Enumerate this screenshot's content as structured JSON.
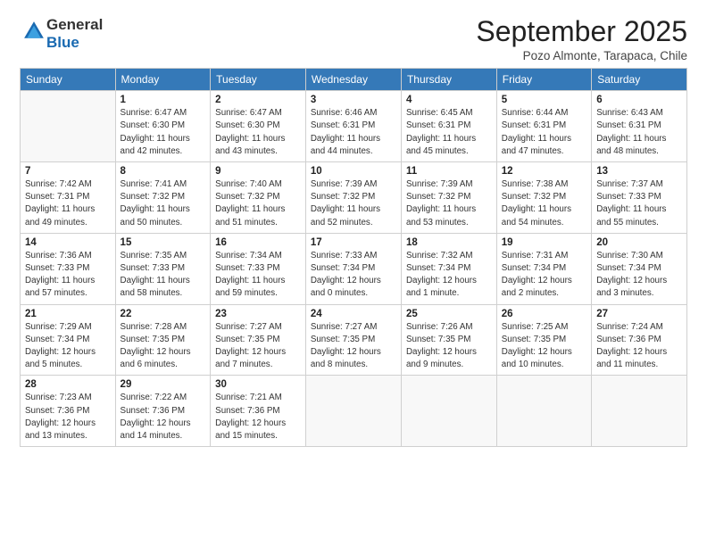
{
  "logo": {
    "general": "General",
    "blue": "Blue"
  },
  "header": {
    "month": "September 2025",
    "location": "Pozo Almonte, Tarapaca, Chile"
  },
  "weekdays": [
    "Sunday",
    "Monday",
    "Tuesday",
    "Wednesday",
    "Thursday",
    "Friday",
    "Saturday"
  ],
  "weeks": [
    [
      {
        "day": null,
        "info": null
      },
      {
        "day": "1",
        "info": "Sunrise: 6:47 AM\nSunset: 6:30 PM\nDaylight: 11 hours\nand 42 minutes."
      },
      {
        "day": "2",
        "info": "Sunrise: 6:47 AM\nSunset: 6:30 PM\nDaylight: 11 hours\nand 43 minutes."
      },
      {
        "day": "3",
        "info": "Sunrise: 6:46 AM\nSunset: 6:31 PM\nDaylight: 11 hours\nand 44 minutes."
      },
      {
        "day": "4",
        "info": "Sunrise: 6:45 AM\nSunset: 6:31 PM\nDaylight: 11 hours\nand 45 minutes."
      },
      {
        "day": "5",
        "info": "Sunrise: 6:44 AM\nSunset: 6:31 PM\nDaylight: 11 hours\nand 47 minutes."
      },
      {
        "day": "6",
        "info": "Sunrise: 6:43 AM\nSunset: 6:31 PM\nDaylight: 11 hours\nand 48 minutes."
      }
    ],
    [
      {
        "day": "7",
        "info": "Sunrise: 7:42 AM\nSunset: 7:31 PM\nDaylight: 11 hours\nand 49 minutes."
      },
      {
        "day": "8",
        "info": "Sunrise: 7:41 AM\nSunset: 7:32 PM\nDaylight: 11 hours\nand 50 minutes."
      },
      {
        "day": "9",
        "info": "Sunrise: 7:40 AM\nSunset: 7:32 PM\nDaylight: 11 hours\nand 51 minutes."
      },
      {
        "day": "10",
        "info": "Sunrise: 7:39 AM\nSunset: 7:32 PM\nDaylight: 11 hours\nand 52 minutes."
      },
      {
        "day": "11",
        "info": "Sunrise: 7:39 AM\nSunset: 7:32 PM\nDaylight: 11 hours\nand 53 minutes."
      },
      {
        "day": "12",
        "info": "Sunrise: 7:38 AM\nSunset: 7:32 PM\nDaylight: 11 hours\nand 54 minutes."
      },
      {
        "day": "13",
        "info": "Sunrise: 7:37 AM\nSunset: 7:33 PM\nDaylight: 11 hours\nand 55 minutes."
      }
    ],
    [
      {
        "day": "14",
        "info": "Sunrise: 7:36 AM\nSunset: 7:33 PM\nDaylight: 11 hours\nand 57 minutes."
      },
      {
        "day": "15",
        "info": "Sunrise: 7:35 AM\nSunset: 7:33 PM\nDaylight: 11 hours\nand 58 minutes."
      },
      {
        "day": "16",
        "info": "Sunrise: 7:34 AM\nSunset: 7:33 PM\nDaylight: 11 hours\nand 59 minutes."
      },
      {
        "day": "17",
        "info": "Sunrise: 7:33 AM\nSunset: 7:34 PM\nDaylight: 12 hours\nand 0 minutes."
      },
      {
        "day": "18",
        "info": "Sunrise: 7:32 AM\nSunset: 7:34 PM\nDaylight: 12 hours\nand 1 minute."
      },
      {
        "day": "19",
        "info": "Sunrise: 7:31 AM\nSunset: 7:34 PM\nDaylight: 12 hours\nand 2 minutes."
      },
      {
        "day": "20",
        "info": "Sunrise: 7:30 AM\nSunset: 7:34 PM\nDaylight: 12 hours\nand 3 minutes."
      }
    ],
    [
      {
        "day": "21",
        "info": "Sunrise: 7:29 AM\nSunset: 7:34 PM\nDaylight: 12 hours\nand 5 minutes."
      },
      {
        "day": "22",
        "info": "Sunrise: 7:28 AM\nSunset: 7:35 PM\nDaylight: 12 hours\nand 6 minutes."
      },
      {
        "day": "23",
        "info": "Sunrise: 7:27 AM\nSunset: 7:35 PM\nDaylight: 12 hours\nand 7 minutes."
      },
      {
        "day": "24",
        "info": "Sunrise: 7:27 AM\nSunset: 7:35 PM\nDaylight: 12 hours\nand 8 minutes."
      },
      {
        "day": "25",
        "info": "Sunrise: 7:26 AM\nSunset: 7:35 PM\nDaylight: 12 hours\nand 9 minutes."
      },
      {
        "day": "26",
        "info": "Sunrise: 7:25 AM\nSunset: 7:35 PM\nDaylight: 12 hours\nand 10 minutes."
      },
      {
        "day": "27",
        "info": "Sunrise: 7:24 AM\nSunset: 7:36 PM\nDaylight: 12 hours\nand 11 minutes."
      }
    ],
    [
      {
        "day": "28",
        "info": "Sunrise: 7:23 AM\nSunset: 7:36 PM\nDaylight: 12 hours\nand 13 minutes."
      },
      {
        "day": "29",
        "info": "Sunrise: 7:22 AM\nSunset: 7:36 PM\nDaylight: 12 hours\nand 14 minutes."
      },
      {
        "day": "30",
        "info": "Sunrise: 7:21 AM\nSunset: 7:36 PM\nDaylight: 12 hours\nand 15 minutes."
      },
      {
        "day": null,
        "info": null
      },
      {
        "day": null,
        "info": null
      },
      {
        "day": null,
        "info": null
      },
      {
        "day": null,
        "info": null
      }
    ]
  ]
}
